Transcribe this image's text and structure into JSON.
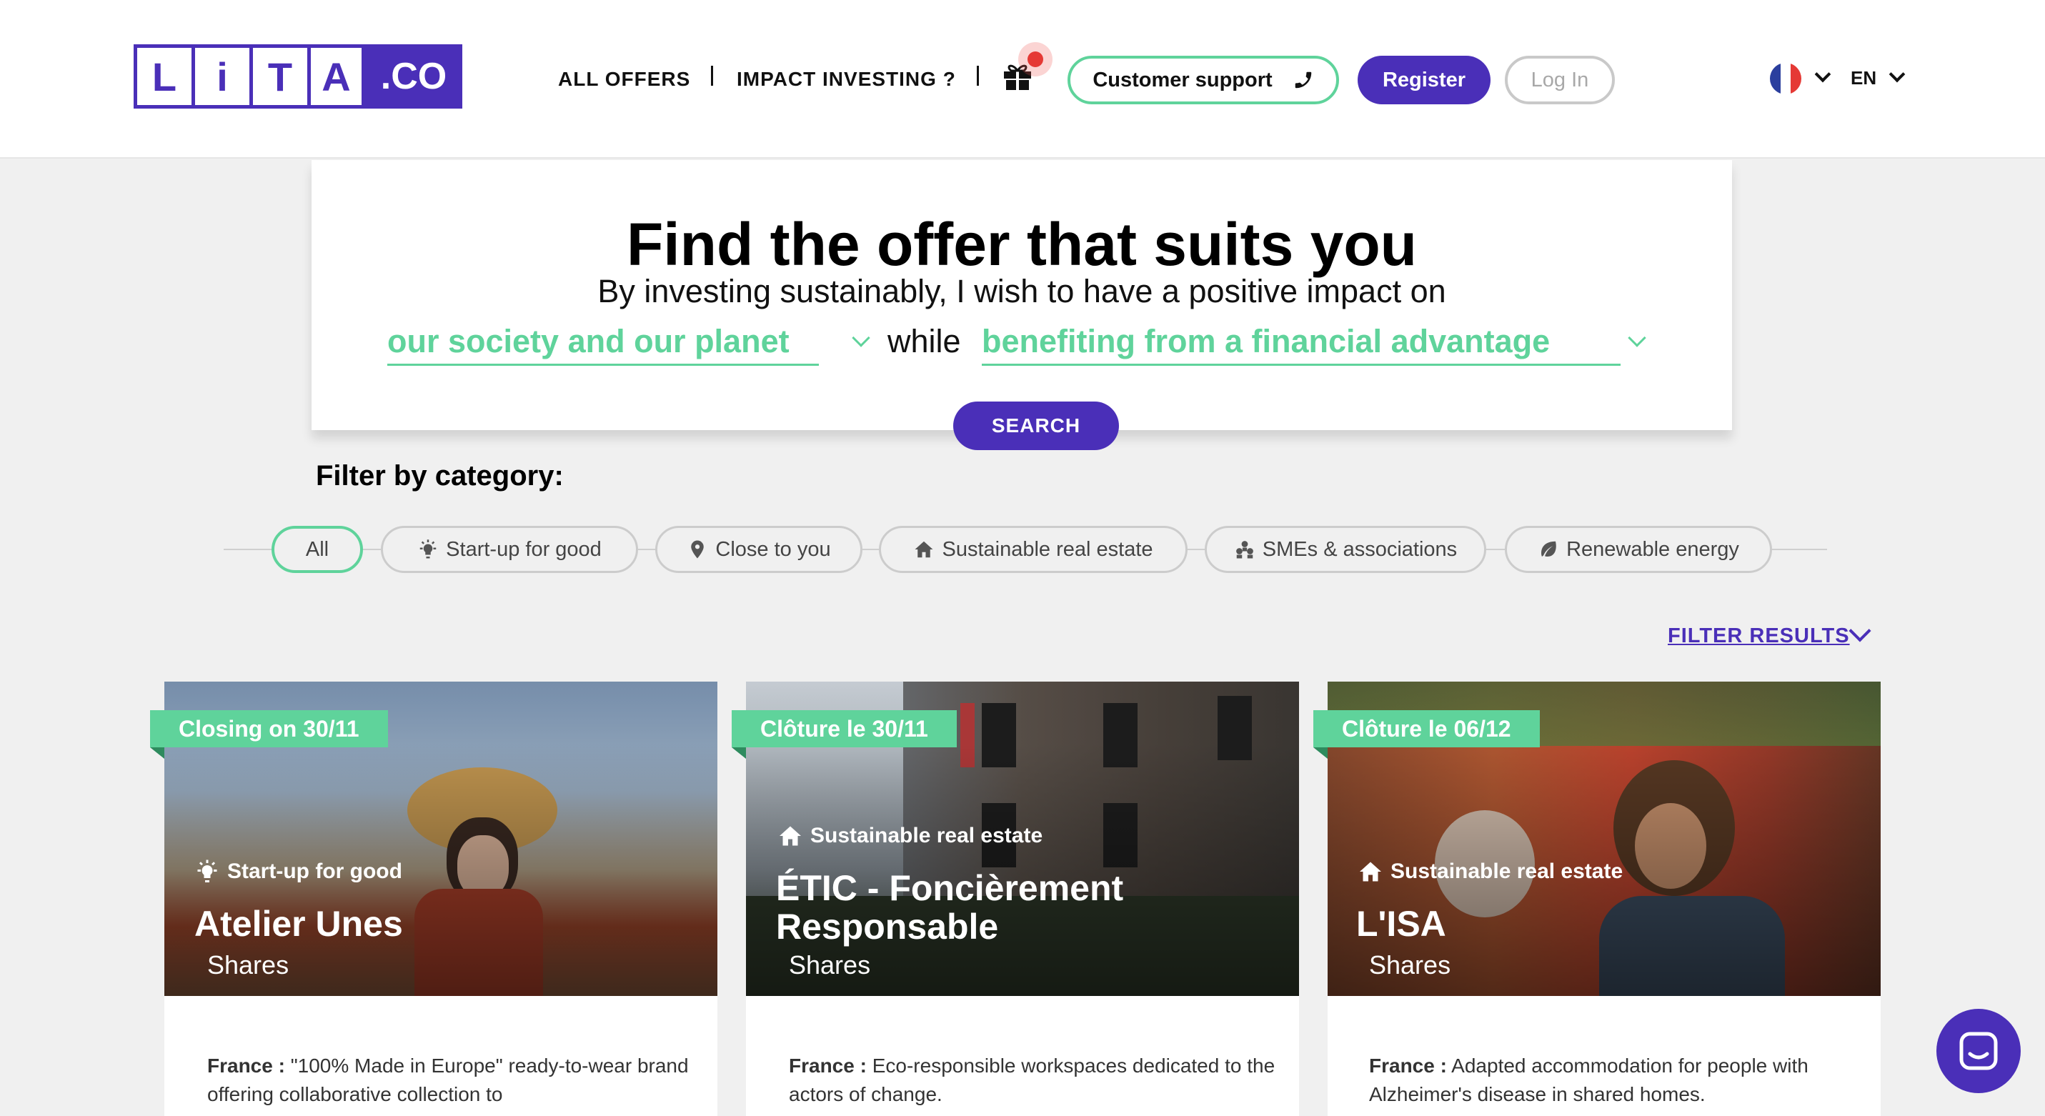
{
  "header": {
    "logo_letters": [
      "L",
      "i",
      "T",
      "A"
    ],
    "logo_suffix": ".CO",
    "nav": [
      "ALL OFFERS",
      "IMPACT INVESTING ?"
    ],
    "gift_icon": "gift-icon",
    "customer_support": "Customer support",
    "register": "Register",
    "login": "Log In",
    "language": "EN",
    "colors": {
      "brand": "#4a2fb8",
      "accent": "#5fd39b"
    }
  },
  "search": {
    "title": "Find the offer that suits you",
    "subtitle": "By investing sustainably, I wish to have a positive impact on",
    "impact_select": "our society and our planet",
    "connector": "while",
    "benefit_select": "benefiting from a financial advantage",
    "button": "SEARCH"
  },
  "filters": {
    "title": "Filter by category:",
    "chips": [
      "All",
      "Start-up for good",
      "Close to you",
      "Sustainable real estate",
      "SMEs & associations",
      "Renewable energy"
    ],
    "active": "All",
    "filter_results": "FILTER RESULTS"
  },
  "cards": [
    {
      "badge": "Closing on 30/11",
      "category": "Start-up for good",
      "title": "Atelier Unes",
      "type": "Shares",
      "country": "France :",
      "description": "\"100% Made in Europe\" ready-to-wear brand offering collaborative collection to"
    },
    {
      "badge": "Clôture le 30/11",
      "category": "Sustainable real estate",
      "title_line1": "ÉTIC - Foncièrement",
      "title_line2": "Responsable",
      "type": "Shares",
      "country": "France :",
      "description": "Eco-responsible workspaces dedicated to the actors of change."
    },
    {
      "badge": "Clôture le 06/12",
      "category": "Sustainable real estate",
      "title": "L'ISA",
      "type": "Shares",
      "country": "France :",
      "description": "Adapted accommodation for people with Alzheimer's disease in shared homes."
    }
  ]
}
